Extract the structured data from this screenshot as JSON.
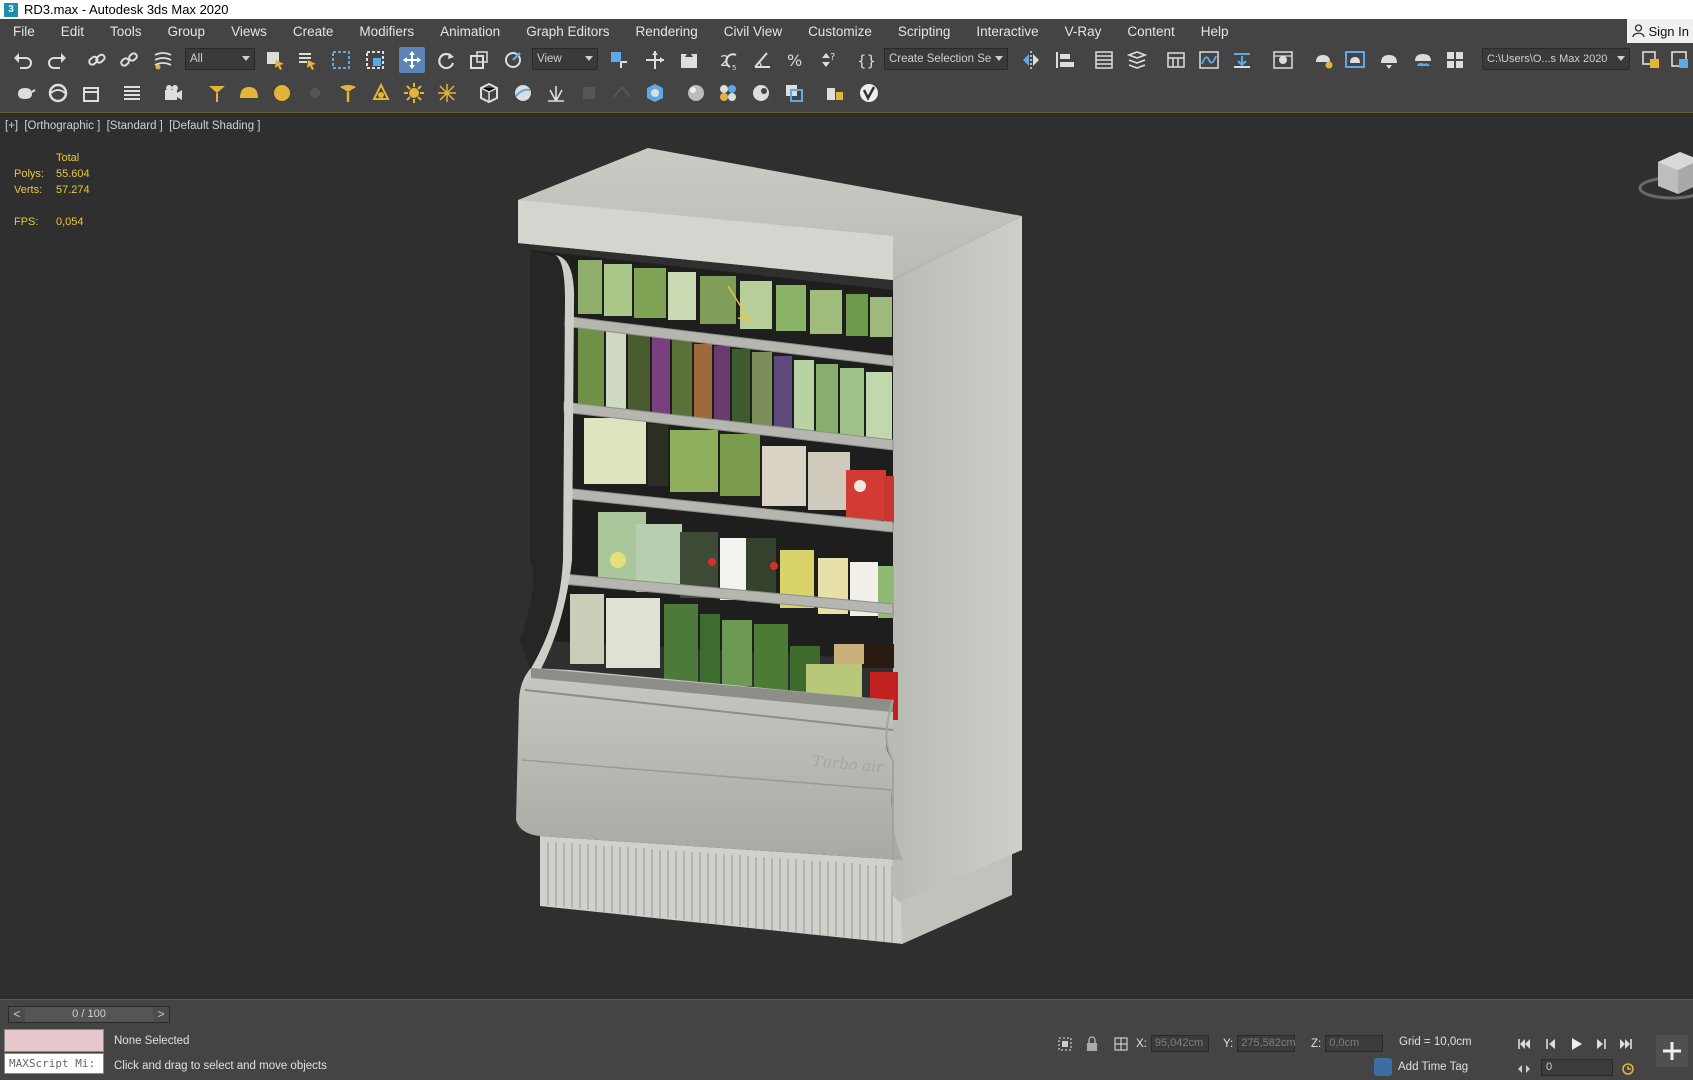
{
  "window": {
    "app_icon": "3",
    "title": "RD3.max - Autodesk 3ds Max 2020"
  },
  "menu": {
    "items": [
      "File",
      "Edit",
      "Tools",
      "Group",
      "Views",
      "Create",
      "Modifiers",
      "Animation",
      "Graph Editors",
      "Rendering",
      "Civil View",
      "Customize",
      "Scripting",
      "Interactive",
      "V-Ray",
      "Content",
      "Help"
    ],
    "sign_in": "Sign In"
  },
  "toolbar": {
    "selection_filter": "All",
    "reference_coord": "View",
    "named_selection": "Create Selection Se",
    "project_path": "C:\\Users\\O...s Max 2020"
  },
  "viewport": {
    "labels": [
      "[+]",
      "[Orthographic ]",
      "[Standard ]",
      "[Default Shading ]"
    ],
    "stats": {
      "total_label": "Total",
      "polys_label": "Polys:",
      "polys_value": "55.604",
      "verts_label": "Verts:",
      "verts_value": "57.274",
      "fps_label": "FPS:",
      "fps_value": "0,054"
    },
    "model_brand": "Turbo air"
  },
  "timeline": {
    "prev": "<",
    "frame": "0 / 100",
    "next": ">"
  },
  "status": {
    "maxscript_placeholder": "MAXScript Mi:",
    "selection": "None Selected",
    "prompt": "Click and drag to select and move objects",
    "x_label": "X:",
    "x_value": "95,042cm",
    "y_label": "Y:",
    "y_value": "275,582cm",
    "z_label": "Z:",
    "z_value": "0,0cm",
    "grid": "Grid = 10,0cm",
    "add_time_tag": "Add Time Tag",
    "current_frame": "0"
  },
  "colors": {
    "ui_bg": "#444444",
    "viewport_bg": "#2f2f2f",
    "stats_text": "#e8c83a",
    "active_tool": "#5b84b6",
    "accent_border": "#6b5a2c"
  }
}
